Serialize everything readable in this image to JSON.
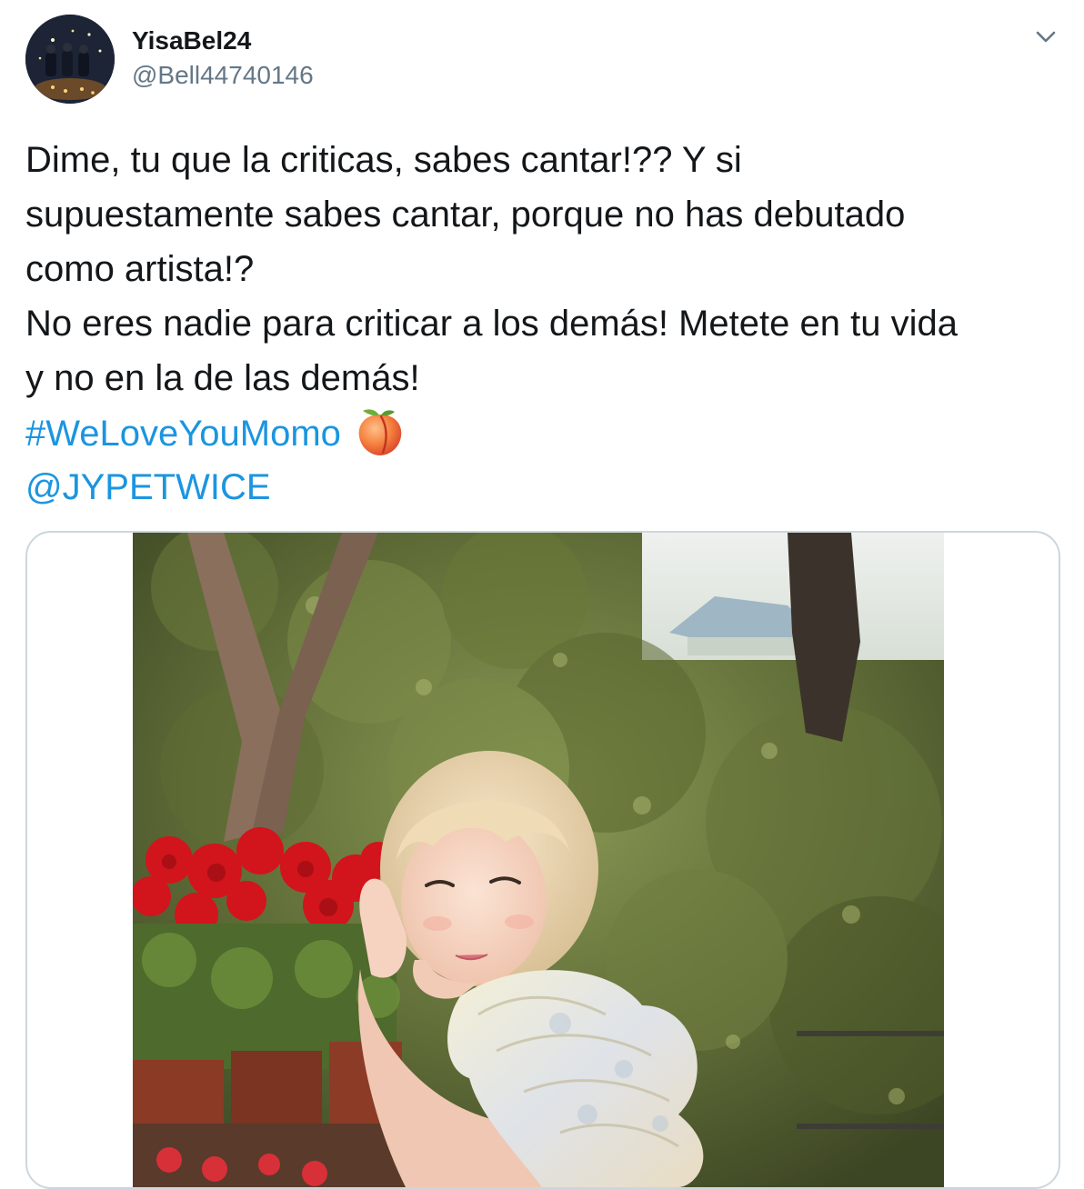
{
  "tweet": {
    "author": {
      "display_name": "YisaBel24",
      "handle": "@Bell44740146",
      "avatar_icon": "profile-photo"
    },
    "menu_icon": "chevron-down-icon",
    "text_lines": [
      "Dime, tu que la criticas, sabes cantar!?? Y si",
      "supuestamente sabes cantar, porque no has debutado",
      "como artista!?",
      "No eres nadie para criticar a los demás! Metete en tu vida",
      "y no en la de las demás!"
    ],
    "hashtag": "#WeLoveYouMomo",
    "hashtag_emoji": "peach-emoji",
    "mention": "@JYPETWICE",
    "media": {
      "type": "photo"
    }
  },
  "colors": {
    "text": "#14171a",
    "secondary": "#657786",
    "link": "#1b95e0",
    "border": "#ccd6dd"
  }
}
